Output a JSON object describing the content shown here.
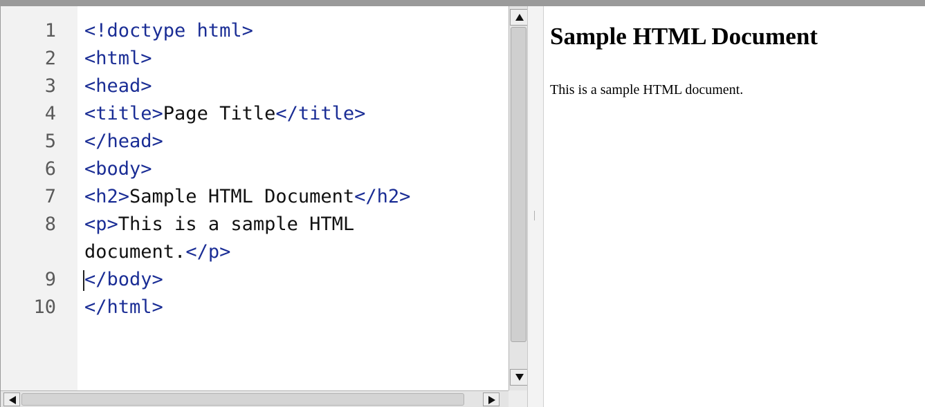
{
  "editor": {
    "lines": [
      {
        "num": "1",
        "parts": [
          {
            "t": "tag",
            "v": "<!doctype html>"
          }
        ]
      },
      {
        "num": "2",
        "parts": [
          {
            "t": "tag",
            "v": "<html>"
          }
        ]
      },
      {
        "num": "3",
        "parts": [
          {
            "t": "tag",
            "v": "<head>"
          }
        ]
      },
      {
        "num": "4",
        "parts": [
          {
            "t": "tag",
            "v": "<title>"
          },
          {
            "t": "txt",
            "v": "Page Title"
          },
          {
            "t": "tag",
            "v": "</title>"
          }
        ]
      },
      {
        "num": "5",
        "parts": [
          {
            "t": "tag",
            "v": "</head>"
          }
        ]
      },
      {
        "num": "6",
        "parts": [
          {
            "t": "tag",
            "v": "<body>"
          }
        ]
      },
      {
        "num": "7",
        "parts": [
          {
            "t": "tag",
            "v": "<h2>"
          },
          {
            "t": "txt",
            "v": "Sample HTML Document"
          },
          {
            "t": "tag",
            "v": "</h2>"
          }
        ]
      },
      {
        "num": "8",
        "parts": [
          {
            "t": "tag",
            "v": "<p>"
          },
          {
            "t": "txt",
            "v": "This is a sample HTML"
          }
        ]
      },
      {
        "num": "",
        "parts": [
          {
            "t": "txt",
            "v": "document."
          },
          {
            "t": "tag",
            "v": "</p>"
          }
        ]
      },
      {
        "num": "9",
        "parts": [
          {
            "t": "tag",
            "v": "</body>"
          }
        ],
        "caret": true
      },
      {
        "num": "10",
        "parts": [
          {
            "t": "tag",
            "v": "</html>"
          }
        ]
      }
    ],
    "colors": {
      "tag": "#1a2d95",
      "text": "#111111",
      "line_number": "#5a5a5a",
      "gutter_bg": "#f2f2f2"
    }
  },
  "preview": {
    "heading": "Sample HTML Document",
    "paragraph": "This is a sample HTML document."
  },
  "icons": {
    "scroll_up": "triangle-up-icon",
    "scroll_down": "triangle-down-icon",
    "scroll_left": "triangle-left-icon",
    "scroll_right": "triangle-right-icon"
  }
}
